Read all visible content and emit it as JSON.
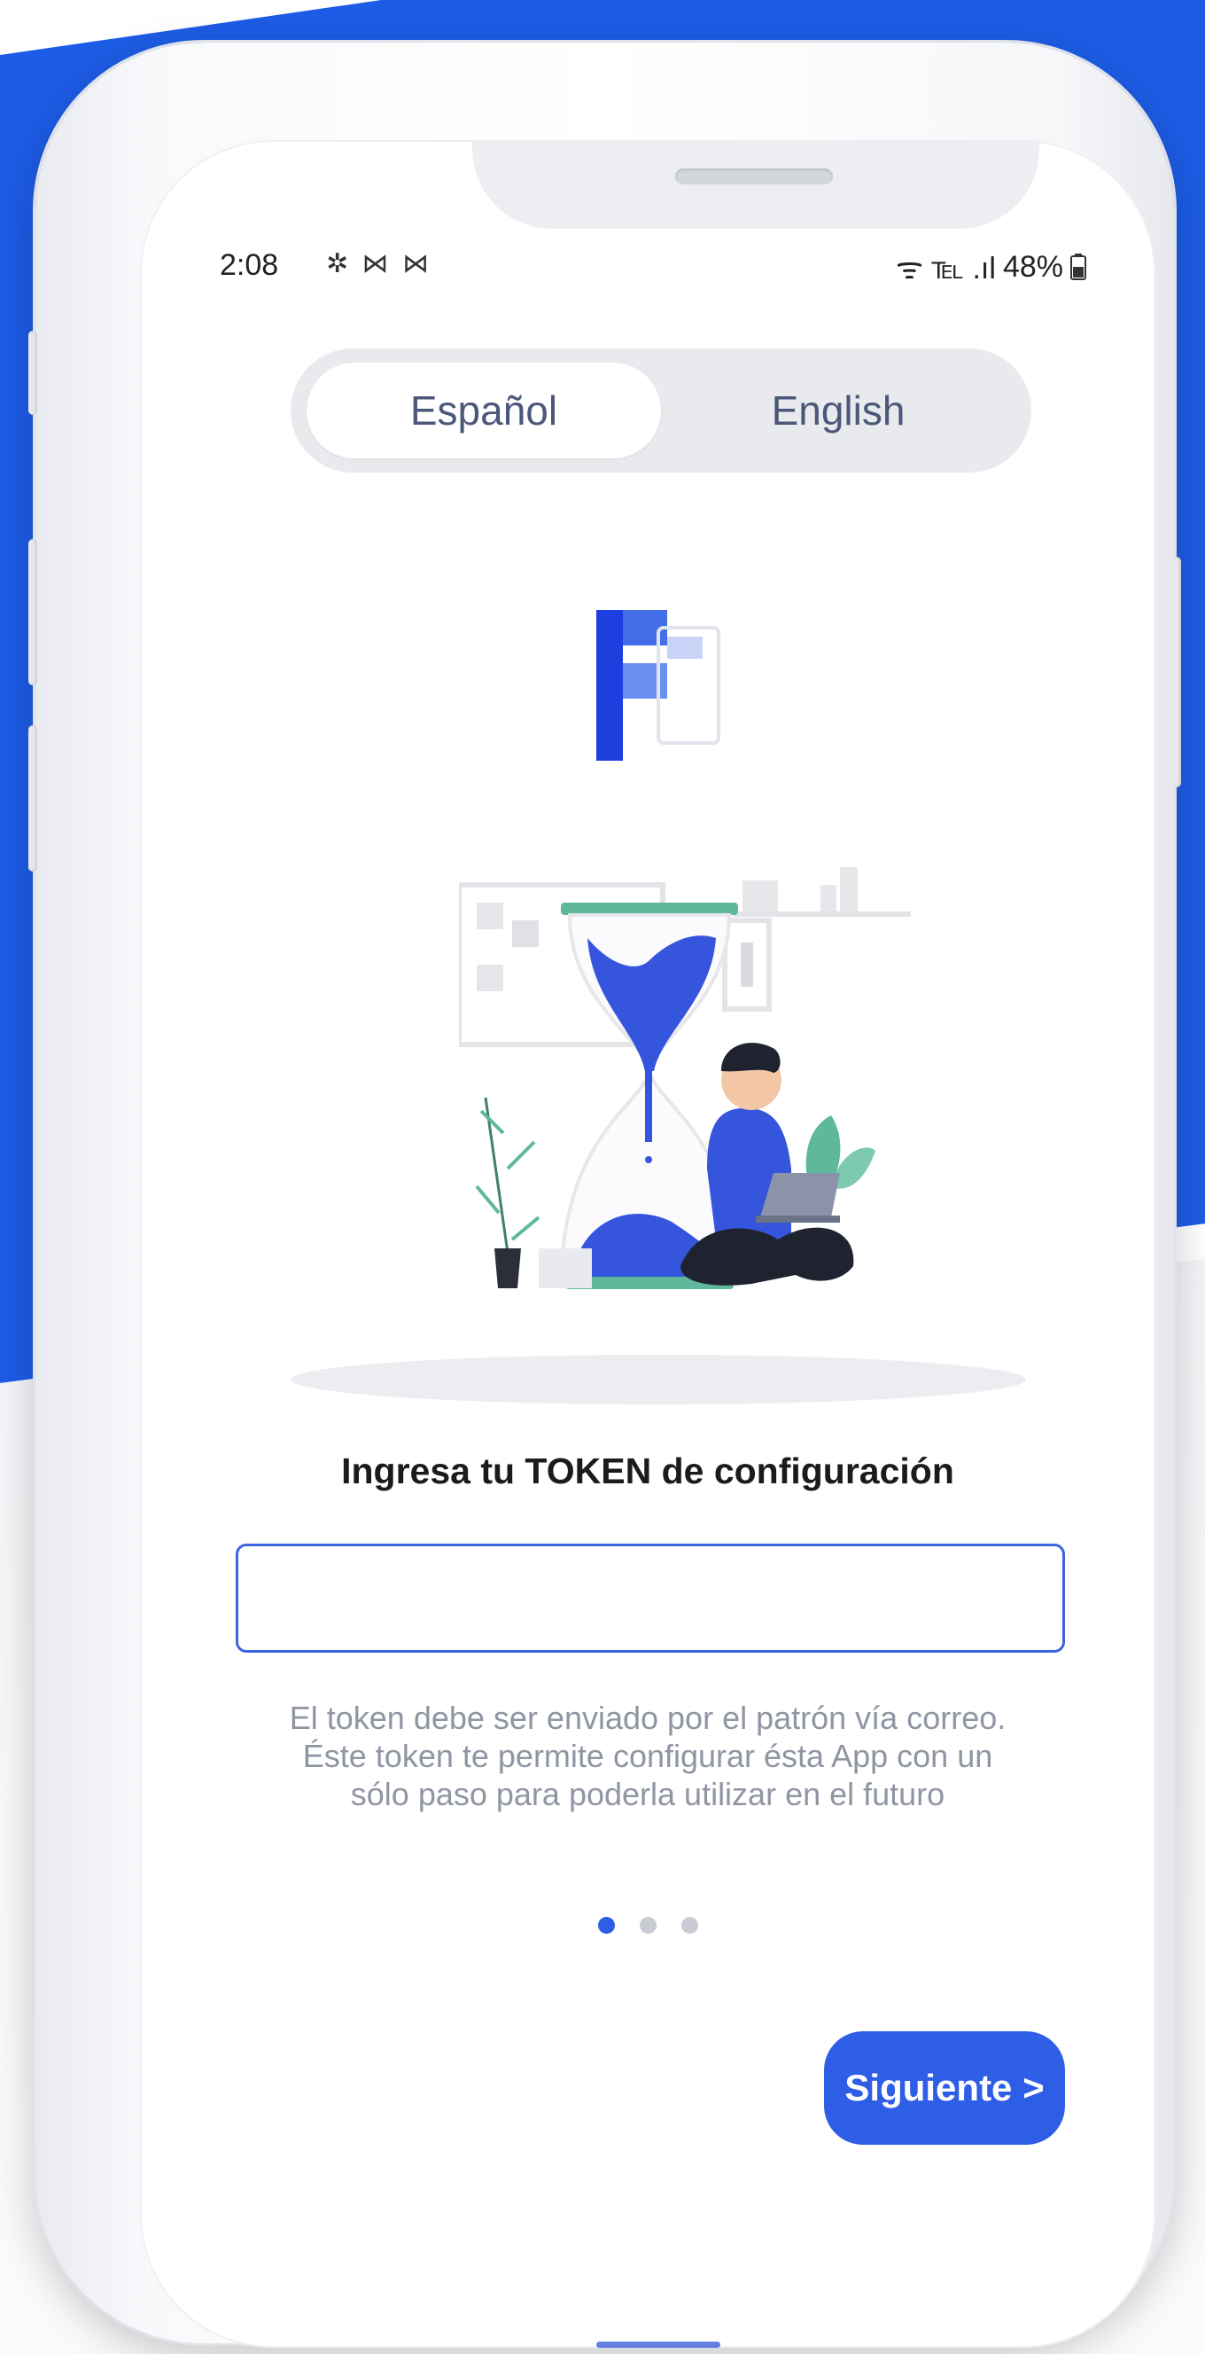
{
  "status_bar": {
    "time": "2:08",
    "notification_icons": "✲ ⋈ ⋈",
    "signal_text": "ᯤ ℡ .ıl",
    "battery": "48%"
  },
  "language_toggle": {
    "selected": "Español",
    "options": [
      "Español",
      "English"
    ]
  },
  "token_prompt": "Ingresa tu TOKEN de configuración",
  "token_input": {
    "value": "",
    "placeholder": ""
  },
  "helper_text": [
    "El token debe ser enviado por el patrón vía correo.",
    "Éste token te permite configurar ésta App con un",
    "sólo paso para poderla utilizar en el futuro"
  ],
  "pagination": {
    "current": 1,
    "total": 3
  },
  "next_button": "Siguiente >",
  "colors": {
    "accent": "#2f5ee6",
    "background_blue": "#1d5ce6",
    "toggle_bg": "#e9eaed",
    "helper_text": "#8f95a3"
  }
}
